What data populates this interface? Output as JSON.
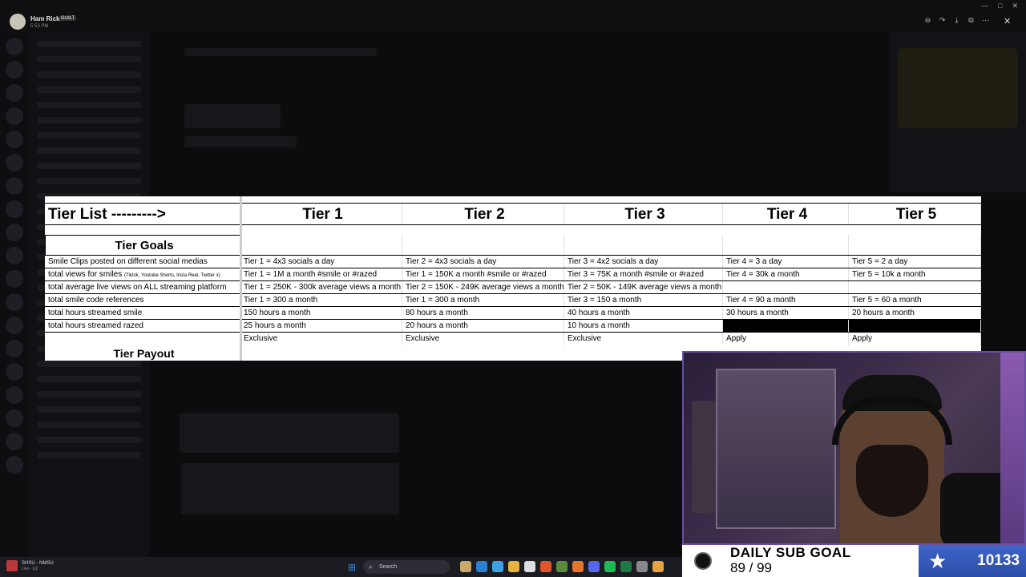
{
  "window": {
    "user_name": "Ham Rick",
    "user_badge": "GUILT",
    "user_time": "5:53 PM",
    "viewer_icons": [
      "zoom-out-icon",
      "redo-icon",
      "download-icon",
      "open-external-icon",
      "more-icon"
    ],
    "close_glyph": "✕"
  },
  "sheet": {
    "headers": [
      "Tier List --------->",
      "Tier 1",
      "Tier 2",
      "Tier 3",
      "Tier 4",
      "Tier 5"
    ],
    "goals_label": "Tier Goals",
    "rows": [
      {
        "label": "Smile Clips posted on different social medias",
        "label_small": "",
        "cells": [
          "Tier 1 = 4x3 socials a day",
          "Tier 2 = 4x3 socials a day",
          "Tier 3 = 4x2 socials a day",
          "Tier 4 = 3 a day",
          "Tier 5 = 2 a day"
        ]
      },
      {
        "label": "total views for smiles",
        "label_small": "(Tiktok, Youtube Shorts, Insta Reel, Twitter x)",
        "cells": [
          "Tier 1 = 1M a month #smile or #razed",
          "Tier 1 = 150K a month #smile or #razed",
          "Tier 3 = 75K a month #smile or #razed",
          "Tier 4 = 30k a month",
          "Tier 5 = 10k a month"
        ]
      },
      {
        "label": "total average live views on ALL streaming platform",
        "label_small": "",
        "cells": [
          "Tier 1 = 250K - 300k average views a month",
          "Tier 2 = 150K - 249K average views a month",
          "Tier 2 = 50K - 149K average views a month",
          "",
          ""
        ]
      },
      {
        "label": "total smile code references",
        "label_small": "",
        "cells": [
          "Tier 1 = 300 a month",
          "Tier 1 = 300 a month",
          "Tier 3 = 150 a month",
          "Tier 4 = 90 a month",
          "Tier 5 = 60 a month"
        ]
      },
      {
        "label": "total hours streamed smile",
        "label_small": "",
        "cells": [
          "150 hours a month",
          "80 hours a month",
          "40 hours a month",
          "30 hours a month",
          "20 hours a month"
        ]
      },
      {
        "label": "total hours streamed razed",
        "label_small": "",
        "cells": [
          "25 hours a month",
          "20 hours a month",
          "10 hours a month",
          "",
          ""
        ]
      },
      {
        "label": "",
        "label_small": "",
        "cells": [
          "Exclusive",
          "Exclusive",
          "Exclusive",
          "Apply",
          "Apply"
        ]
      }
    ],
    "payout_label": "Tier Payout"
  },
  "subgoal": {
    "title": "DAILY SUB GOAL",
    "progress": "89 / 99",
    "count": "10133",
    "accent": "#3f64c8"
  },
  "taskbar": {
    "media_title": "SHSU - NMSU",
    "media_subtitle": "Live - Q2",
    "search_label": "Search",
    "start_icon": "windows-start-icon"
  }
}
